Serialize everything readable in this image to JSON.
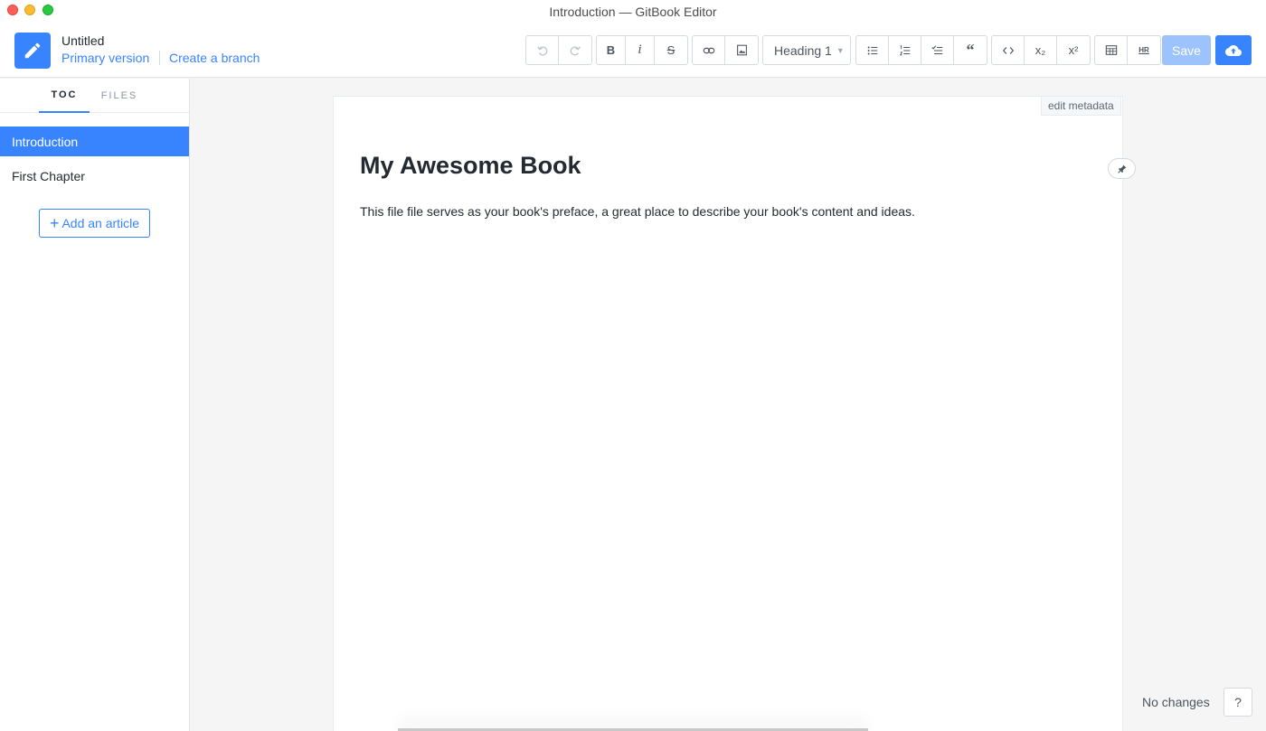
{
  "window": {
    "title": "Introduction — GitBook Editor"
  },
  "header": {
    "book_title": "Untitled",
    "version_link": "Primary version",
    "branch_link": "Create a branch"
  },
  "toolbar": {
    "undo_icon": "undo-icon",
    "redo_icon": "redo-icon",
    "bold_label": "B",
    "italic_label": "i",
    "strike_label": "S",
    "heading_select": "Heading 1",
    "subscript_label": "x₂",
    "superscript_label": "x²",
    "hr_label": "HR",
    "save_label": "Save",
    "publish_icon": "cloud-upload-icon"
  },
  "sidebar": {
    "tabs": [
      {
        "label": "TOC",
        "active": true
      },
      {
        "label": "FILES",
        "active": false
      }
    ],
    "items": [
      {
        "label": "Introduction",
        "active": true
      },
      {
        "label": "First Chapter",
        "active": false
      }
    ],
    "add_article_label": "Add an article"
  },
  "editor": {
    "edit_metadata": "edit metadata",
    "title": "My Awesome Book",
    "body": "This file file serves as your book's preface, a great place to describe your book's content and ideas."
  },
  "status": {
    "text": "No changes",
    "help_label": "?"
  },
  "colors": {
    "accent": "#3884ff",
    "save_disabled": "#9dc3fd"
  }
}
